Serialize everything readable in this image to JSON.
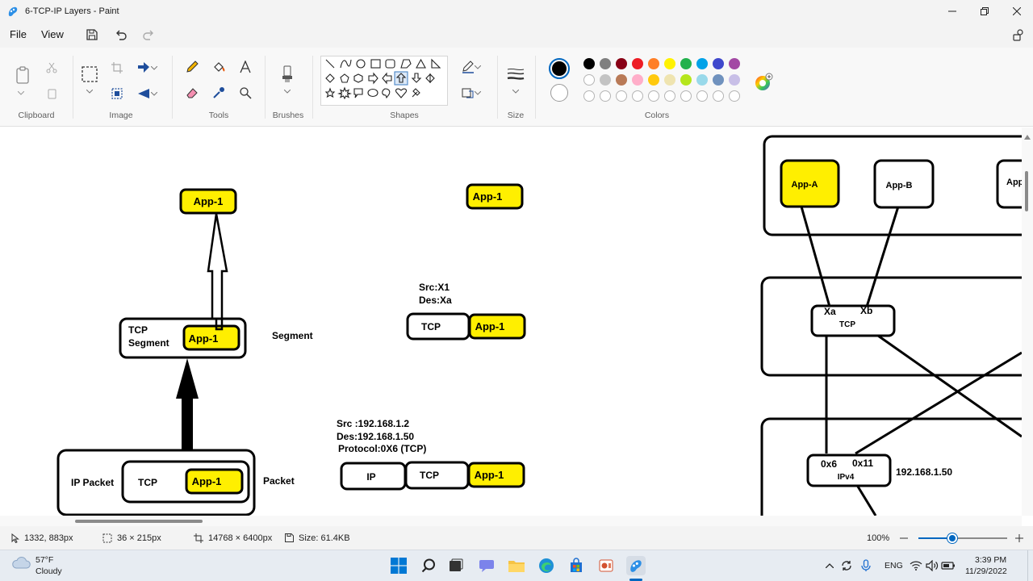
{
  "window": {
    "title": "6-TCP-IP Layers - Paint"
  },
  "menu": {
    "file": "File",
    "view": "View"
  },
  "ribbon": {
    "groups": {
      "clipboard": "Clipboard",
      "image": "Image",
      "tools": "Tools",
      "brushes": "Brushes",
      "shapes": "Shapes",
      "size": "Size",
      "colors": "Colors"
    },
    "primary_color": "#000000",
    "secondary_color": "#ffffff",
    "palette_row1": [
      "#000000",
      "#7f7f7f",
      "#880015",
      "#ed1c24",
      "#ff7f27",
      "#fff200",
      "#22b14c",
      "#00a2e8",
      "#3f48cc",
      "#a349a4"
    ],
    "palette_row2": [
      "#ffffff",
      "#c3c3c3",
      "#b97a57",
      "#ffaec9",
      "#ffc90e",
      "#efe4b0",
      "#b5e61d",
      "#99d9ea",
      "#7092be",
      "#c8bfe7"
    ]
  },
  "canvas": {
    "highlight_color": "#ffef00",
    "diagram_left": {
      "top_app": "App-1",
      "segment_box": {
        "line1": "TCP",
        "line2": "Segment",
        "app": "App-1"
      },
      "segment_label": "Segment",
      "packet_box": {
        "label": "IP Packet",
        "tcp": "TCP",
        "app": "App-1"
      },
      "packet_label": "Packet"
    },
    "diagram_middle": {
      "top_app": "App-1",
      "segment_header": {
        "src": "Src:X1",
        "des": "Des:Xa"
      },
      "segment": {
        "tcp": "TCP",
        "app": "App-1"
      },
      "packet_header": {
        "src": "Src :192.168.1.2",
        "des": "Des:192.168.1.50",
        "protocol": "Protocol:0X6 (TCP)"
      },
      "packet": {
        "ip": "IP",
        "tcp": "TCP",
        "app": "App-1"
      }
    },
    "diagram_right": {
      "app_a": "App-A",
      "app_b": "App-B",
      "app_c": "App",
      "port_a": "Xa",
      "port_b": "Xb",
      "tcp": "TCP",
      "proto_tcp": "0x6",
      "proto_udp": "0x11",
      "ipv4": "IPv4",
      "ip_address": "192.168.1.50"
    }
  },
  "status": {
    "cursor_pos": "1332, 883px",
    "selection_size": "36 × 215px",
    "canvas_size": "14768 × 6400px",
    "file_size": "Size: 61.4KB",
    "zoom": "100%",
    "zoom_fraction": 0.38
  },
  "taskbar": {
    "weather_temp": "57°F",
    "weather_desc": "Cloudy",
    "language": "ENG",
    "time": "3:39 PM",
    "date": "11/29/2022"
  }
}
